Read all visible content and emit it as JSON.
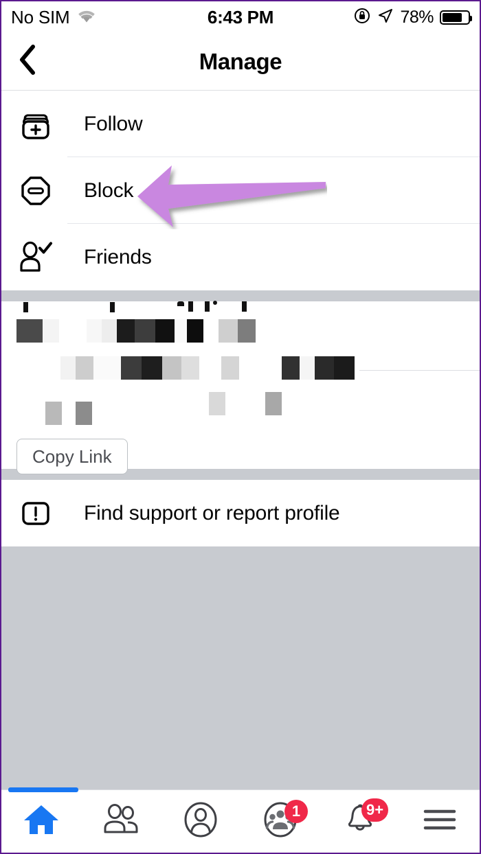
{
  "status_bar": {
    "carrier": "No SIM",
    "wifi_icon": "wifi-icon",
    "time": "6:43 PM",
    "rotation_lock_icon": "rotation-lock-icon",
    "location_icon": "location-arrow-icon",
    "battery_percent": "78%",
    "battery_level": 78
  },
  "header": {
    "back_icon": "chevron-left-icon",
    "title": "Manage"
  },
  "menu_section": {
    "items": [
      {
        "id": "follow",
        "label": "Follow",
        "icon": "follow-card-plus-icon"
      },
      {
        "id": "block",
        "label": "Block",
        "icon": "block-octagon-icon"
      },
      {
        "id": "friends",
        "label": "Friends",
        "icon": "person-check-icon"
      }
    ]
  },
  "link_section": {
    "redacted": true,
    "redacted_note": "profile link text is pixelated/censored",
    "copy_link_label": "Copy Link"
  },
  "report_section": {
    "label": "Find support or report profile",
    "icon": "exclamation-box-icon"
  },
  "bottom_nav": {
    "active_tab": "home",
    "items": [
      {
        "id": "home",
        "icon": "home-icon",
        "badge": "",
        "active": true
      },
      {
        "id": "friends",
        "icon": "friends-people-icon",
        "badge": "",
        "active": false
      },
      {
        "id": "profile",
        "icon": "profile-circle-icon",
        "badge": "",
        "active": false
      },
      {
        "id": "groups",
        "icon": "groups-icon",
        "badge": "1",
        "active": false
      },
      {
        "id": "notifications",
        "icon": "bell-icon",
        "badge": "9+",
        "active": false
      },
      {
        "id": "menu",
        "icon": "hamburger-menu-icon",
        "badge": "",
        "active": false
      }
    ]
  },
  "annotation": {
    "arrow_color": "#c987e0",
    "points_at": "Block"
  },
  "colors": {
    "accent_blue": "#1877f2",
    "badge_red": "#f02849",
    "separator_gray": "#c8cbd0",
    "text_primary": "#050505"
  }
}
